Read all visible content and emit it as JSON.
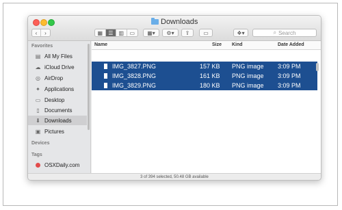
{
  "window": {
    "title": "Downloads",
    "status": "3 of 394 selected, 50.48 GB available"
  },
  "toolbar": {
    "back_icon": "chevron-left-icon",
    "forward_icon": "chevron-right-icon",
    "search_placeholder": "Search",
    "search_icon": "magnifier-icon"
  },
  "sidebar": {
    "favorites_heading": "Favorites",
    "devices_heading": "Devices",
    "tags_heading": "Tags",
    "items": [
      {
        "label": "All My Files",
        "icon": "all-files-icon"
      },
      {
        "label": "iCloud Drive",
        "icon": "cloud-icon"
      },
      {
        "label": "AirDrop",
        "icon": "airdrop-icon"
      },
      {
        "label": "Applications",
        "icon": "applications-icon"
      },
      {
        "label": "Desktop",
        "icon": "desktop-icon"
      },
      {
        "label": "Documents",
        "icon": "documents-icon"
      },
      {
        "label": "Downloads",
        "icon": "downloads-icon",
        "selected": true
      },
      {
        "label": "Pictures",
        "icon": "pictures-icon"
      }
    ],
    "tags": [
      {
        "label": "OSXDaily.com",
        "color": "#e24b4b"
      }
    ]
  },
  "columns": {
    "name": "Name",
    "size": "Size",
    "kind": "Kind",
    "date": "Date Added"
  },
  "files": [
    {
      "name": "IMG_3827.PNG",
      "size": "157 KB",
      "kind": "PNG image",
      "date": "3:09 PM"
    },
    {
      "name": "IMG_3828.PNG",
      "size": "161 KB",
      "kind": "PNG image",
      "date": "3:09 PM"
    },
    {
      "name": "IMG_3829.PNG",
      "size": "180 KB",
      "kind": "PNG image",
      "date": "3:09 PM"
    }
  ],
  "colors": {
    "selection": "#1d4f91",
    "sidebar_selected": "#cfcfd1"
  }
}
